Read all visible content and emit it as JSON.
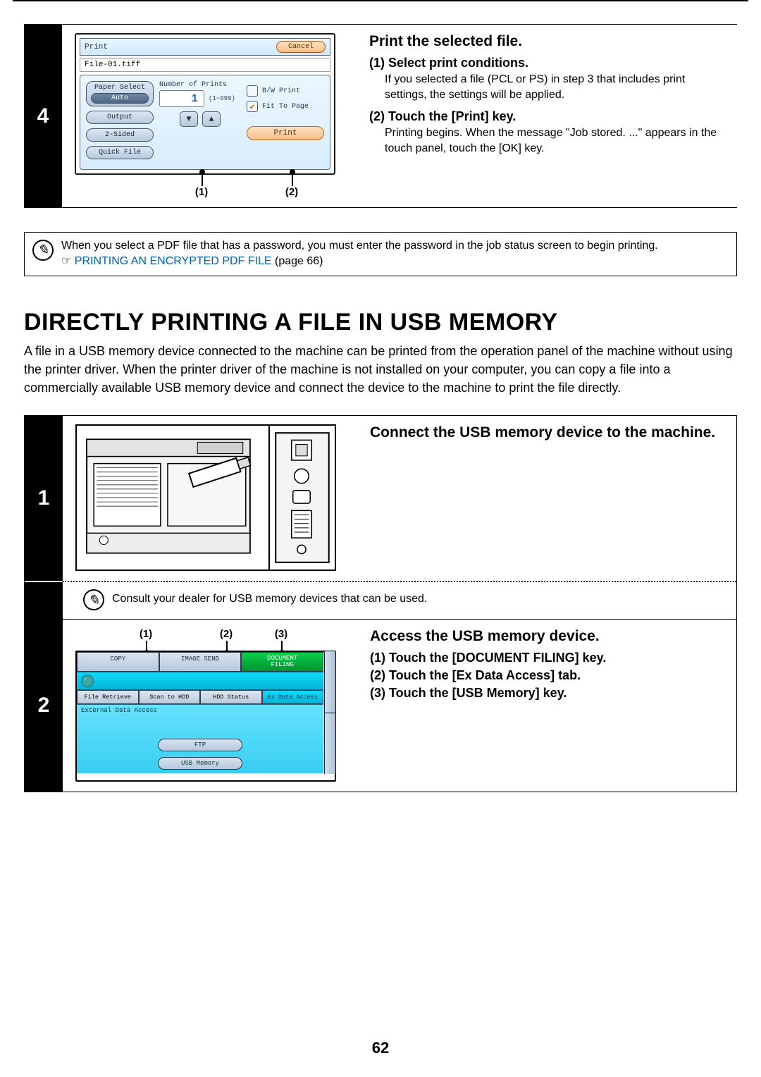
{
  "page_number": "62",
  "step4": {
    "number": "4",
    "heading": "Print the selected file.",
    "items": [
      {
        "title": "(1)  Select print conditions.",
        "body": "If you selected a file (PCL or PS) in step 3 that includes print settings, the settings will be applied."
      },
      {
        "title": "(2)  Touch the [Print] key.",
        "body": "Printing begins. When the message \"Job stored. ...\" appears in the touch panel, touch the [OK] key."
      }
    ],
    "lcd": {
      "title": "Print",
      "cancel": "Cancel",
      "file": "File-01.tiff",
      "paper_select": "Paper Select",
      "auto": "Auto",
      "output": "Output",
      "two_sided": "2-Sided",
      "quick_file": "Quick File",
      "num_label": "Number of Prints",
      "num_value": "1",
      "num_range": "(1~999)",
      "bw": "B/W Print",
      "fit": "Fit To Page",
      "print": "Print"
    },
    "callouts": {
      "c1": "(1)",
      "c2": "(2)"
    }
  },
  "note1": {
    "line1": "When you select a PDF file that has a password, you must enter the password in the job status screen to begin printing.",
    "link_prefix": "☞ ",
    "link_text": "PRINTING AN ENCRYPTED PDF FILE",
    "link_suffix": " (page 66)"
  },
  "section": {
    "title": "DIRECTLY PRINTING A FILE IN USB MEMORY",
    "intro": "A file in a USB memory device connected to the machine can be printed from the operation panel of the machine without using the printer driver. When the printer driver of the machine is not installed on your computer, you can copy a file into a commercially available USB memory device and connect the device to the machine to print the file directly."
  },
  "usb": {
    "step1": {
      "number": "1",
      "heading": "Connect the USB memory device to the machine.",
      "dealer_note": "Consult your dealer for USB memory devices that can be used."
    },
    "step2": {
      "number": "2",
      "heading": "Access the USB memory device.",
      "items": [
        "(1)  Touch the [DOCUMENT FILING] key.",
        "(2)  Touch the [Ex Data Access] tab.",
        "(3)  Touch the [USB Memory] key."
      ],
      "callouts": {
        "c1": "(1)",
        "c2": "(2)",
        "c3": "(3)"
      },
      "lcd": {
        "tabs_top": {
          "copy": "COPY",
          "image_send": "IMAGE SEND",
          "doc_filing_1": "DOCUMENT",
          "doc_filing_2": "FILING"
        },
        "sub_tabs": {
          "retrieve": "File Retrieve",
          "scan": "Scan to HDD",
          "hdd": "HDD Status",
          "ex": "Ex Data Access"
        },
        "panel_label": "External Data Access",
        "ftp": "FTP",
        "usb": "USB Memory"
      }
    }
  }
}
